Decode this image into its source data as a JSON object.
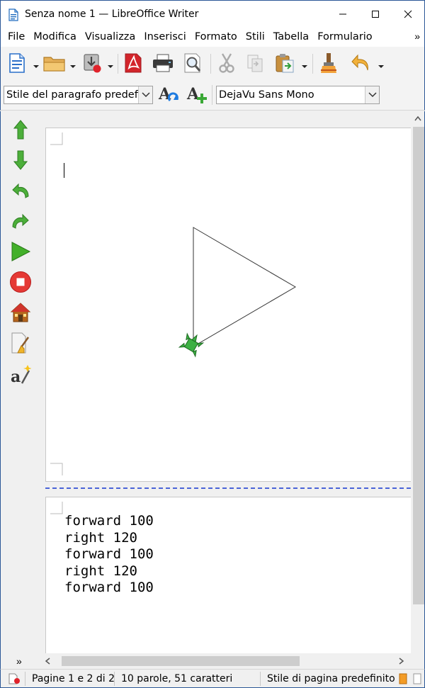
{
  "window": {
    "title": "Senza nome 1 — LibreOffice Writer"
  },
  "menubar": {
    "items": [
      "File",
      "Modifica",
      "Visualizza",
      "Inserisci",
      "Formato",
      "Stili",
      "Tabella",
      "Formulario"
    ],
    "more": "»"
  },
  "formatting": {
    "paragraph_style": "Stile del paragrafo predefinito",
    "font_name": "DejaVu Sans Mono"
  },
  "document": {
    "code_lines": [
      "forward 100",
      "right 120",
      "forward 100",
      "right 120",
      "forward 100"
    ]
  },
  "statusbar": {
    "more": "»",
    "pages": "Pagine 1 e 2 di 2",
    "word_count": "10 parole, 51 caratteri",
    "page_style": "Stile di pagina predefinito"
  },
  "icons": {
    "toolbar": [
      "new-document-icon",
      "open-folder-icon",
      "save-icon",
      "export-pdf-icon",
      "print-icon",
      "print-preview-icon",
      "cut-icon",
      "copy-icon",
      "paste-icon",
      "clone-formatting-icon",
      "undo-icon"
    ],
    "sidebar": [
      "forward-icon",
      "backward-icon",
      "turn-left-icon",
      "turn-right-icon",
      "run-icon",
      "stop-icon",
      "home-icon",
      "clear-screen-icon",
      "translate-icon"
    ]
  },
  "colors": {
    "window_border": "#2b5797",
    "turtle_green": "#3cb043",
    "arrow_green": "#4caf3a",
    "stop_red": "#e53935",
    "page_break_blue": "#4a64d8"
  }
}
